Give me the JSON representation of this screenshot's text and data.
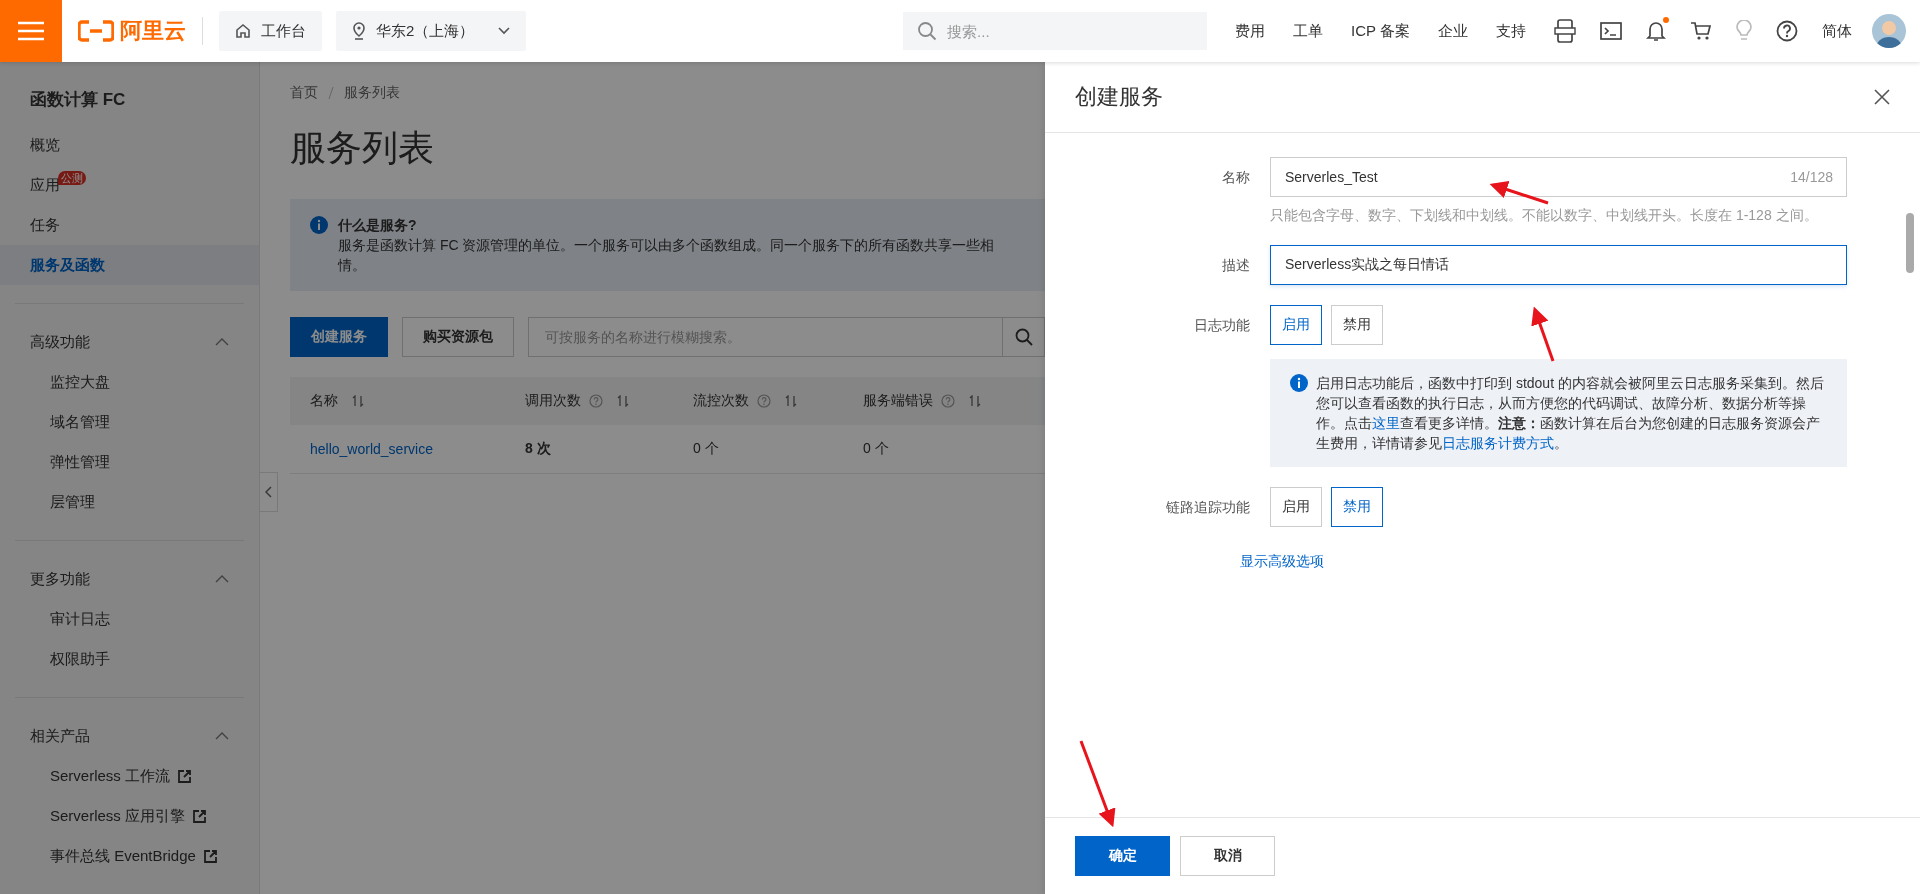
{
  "topbar": {
    "logo": "阿里云",
    "workbench": "工作台",
    "region": "华东2（上海）",
    "search": {
      "placeholder": "搜索..."
    },
    "links": [
      "费用",
      "工单",
      "ICP 备案",
      "企业",
      "支持"
    ],
    "bell_unread": true,
    "language": "简体"
  },
  "sidebar": {
    "title": "函数计算 FC",
    "items": [
      {
        "label": "概览",
        "selected": false
      },
      {
        "label": "应用",
        "badge": "公测",
        "selected": false
      },
      {
        "label": "任务",
        "selected": false
      },
      {
        "label": "服务及函数",
        "selected": true
      }
    ],
    "groups": [
      {
        "title": "高级功能",
        "expanded": true,
        "items": [
          {
            "label": "监控大盘",
            "external": false
          },
          {
            "label": "域名管理",
            "external": false
          },
          {
            "label": "弹性管理",
            "external": false
          },
          {
            "label": "层管理",
            "external": false
          }
        ]
      },
      {
        "title": "更多功能",
        "expanded": true,
        "items": [
          {
            "label": "审计日志",
            "external": false
          },
          {
            "label": "权限助手",
            "external": false
          }
        ]
      },
      {
        "title": "相关产品",
        "expanded": true,
        "items": [
          {
            "label": "Serverless 工作流",
            "external": true
          },
          {
            "label": "Serverless 应用引擎",
            "external": true
          },
          {
            "label": "事件总线 EventBridge",
            "external": true
          }
        ]
      }
    ]
  },
  "main": {
    "breadcrumb": [
      "首页",
      "服务列表"
    ],
    "title": "服务列表",
    "info": {
      "title": "什么是服务?",
      "lines": [
        "服务是函数计算 FC 资源管理的单位。一个服务可以由多个函数组成。同一个服务下的所有函数共享一些相",
        "情。"
      ]
    },
    "buttons": [
      {
        "label": "创建服务",
        "kind": "primary"
      },
      {
        "label": "购买资源包",
        "kind": "default"
      }
    ],
    "search": {
      "placeholder": "可按服务的名称进行模糊搜索。"
    },
    "table": {
      "columns": [
        {
          "label": "名称",
          "help": false
        },
        {
          "label": "调用次数",
          "help": true
        },
        {
          "label": "流控次数",
          "help": true
        },
        {
          "label": "服务端错误",
          "help": true
        }
      ],
      "rows": [
        {
          "cells": [
            "hello_world_service",
            "8 次",
            "0 个",
            "0 个"
          ]
        }
      ]
    }
  },
  "drawer": {
    "title": "创建服务",
    "name_field": {
      "label": "名称",
      "value": "Serverles_Test",
      "counter": "14/128",
      "hint": "只能包含字母、数字、下划线和中划线。不能以数字、中划线开头。长度在 1-128 之间。"
    },
    "description_field": {
      "label": "描述",
      "value": "Serverless实战之每日情话",
      "focused": true
    },
    "log": {
      "label": "日志功能",
      "options": [
        {
          "label": "启用",
          "selected": true
        },
        {
          "label": "禁用",
          "selected": false
        }
      ]
    },
    "log_info": [
      {
        "kind": "text",
        "text": "启用日志功能后，函数中打印到 stdout 的内容就会被阿里云日志服务采集到。然后您可以查看函数的执行日志，从而方便您的代码调试、故障分析、数据分析等操作。点击"
      },
      {
        "kind": "link",
        "text": "这里"
      },
      {
        "kind": "text",
        "text": "查看更多详情。"
      },
      {
        "kind": "bold",
        "text": "注意："
      },
      {
        "kind": "text",
        "text": "函数计算在后台为您创建的日志服务资源会产生费用，详情请参见"
      },
      {
        "kind": "link",
        "text": "日志服务计费方式"
      },
      {
        "kind": "text",
        "text": "。"
      }
    ],
    "trace": {
      "label": "链路追踪功能",
      "options": [
        {
          "label": "启用",
          "selected": false
        },
        {
          "label": "禁用",
          "selected": true
        }
      ]
    },
    "advanced_link": "显示高级选项",
    "buttons": [
      {
        "label": "确定",
        "kind": "primary"
      },
      {
        "label": "取消",
        "kind": "default"
      }
    ]
  }
}
